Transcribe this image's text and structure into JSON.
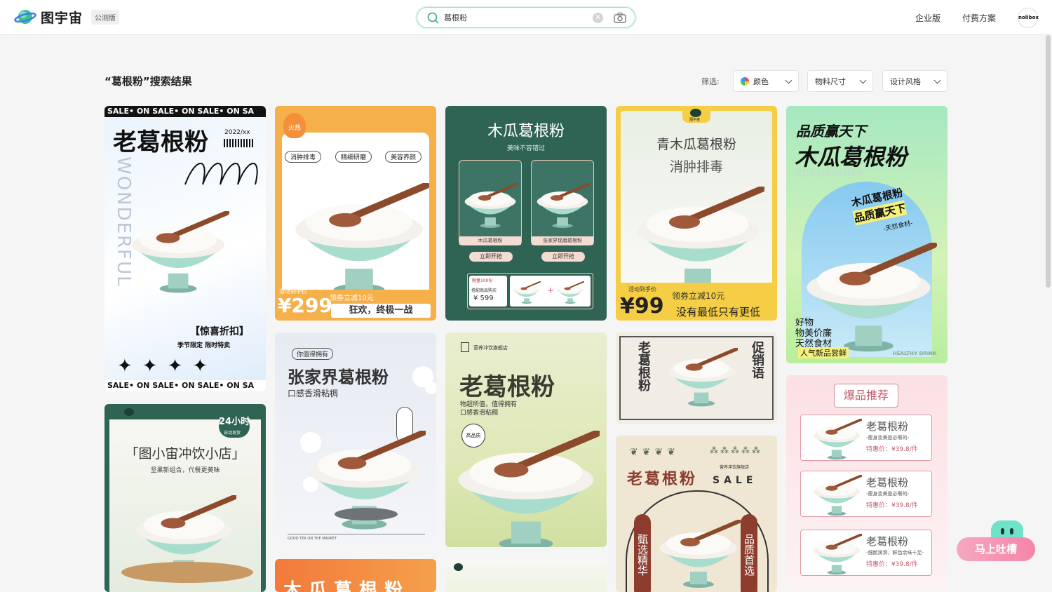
{
  "header": {
    "logo_text": "图宇宙",
    "beta_badge": "公测版",
    "search_value": "葛根粉",
    "nav_enterprise": "企业版",
    "nav_pricing": "付费方案",
    "avatar_text": "nolibox"
  },
  "toolbar": {
    "result_title": "“葛根粉”搜索结果",
    "filter_label": "筛选:",
    "filters": [
      "颜色",
      "物料尺寸",
      "设计风格"
    ]
  },
  "cards": {
    "c1": {
      "ticker": "SALE• ON  SALE• ON  SALE• ON  SA",
      "title": "老葛根粉",
      "year": "2022/xx",
      "vertical": "WONDERFUL",
      "promo": "【惊喜折扣】",
      "sub": "季节限定  限时特卖"
    },
    "c2": {
      "tag": "火热",
      "pills": [
        "消肿排毒",
        "精细研磨",
        "美容养颜"
      ],
      "price_label": "活动到手价",
      "price": "¥299",
      "coupon": "领券立减10元",
      "slogan": "狂欢，终极一战"
    },
    "c3": {
      "title": "木瓜葛根粉",
      "sub": "美味不容错过",
      "item1": "木瓜葛根粉",
      "item2": "张家界现磨葛根粉",
      "btn": "立即开抢",
      "limit": "限量100份",
      "combo": "搭配商品购买",
      "price": "¥ 599"
    },
    "c4": {
      "brand": "图宇宙",
      "title": "青木瓜葛根粉",
      "sub": "消肿排毒",
      "price_label": "活动到手价",
      "price": "¥99",
      "coupon": "领券立减10元",
      "slogan": "没有最低只有更低"
    },
    "c5": {
      "title1": "品质赢天下",
      "title2": "木瓜葛根粉",
      "tag": "#DELICIOUS#",
      "bubble1": "木瓜葛根粉",
      "bubble2": "品质赢天下",
      "bubble3": "-天然食材-",
      "feat1": "好物",
      "feat2": "物美价廉",
      "feat3": "天然食材",
      "feat4": "人气新品尝鲜",
      "foot": "HEALTHY DRINK"
    },
    "c6": {
      "tag": "你值得拥有",
      "title": "张家界葛根粉",
      "sub": "口感香滑粘稠",
      "foot": "GOOD TEA ON THE MARKET"
    },
    "c7": {
      "brand": "营养冲饮旗舰店",
      "title": "老葛根粉",
      "sub1": "物超所值，值得拥有",
      "sub2": "口感香滑粘稠",
      "badge": "高品质"
    },
    "c8": {
      "title": "老葛根粉",
      "right": "促销语"
    },
    "c9": {
      "title": "爆品推荐",
      "item": "老葛根粉",
      "desc1": "-瘦身变美是必需的-",
      "desc3": "-细腻润滑，鲜齿余味十足-",
      "price": "特惠价：¥39.8/件"
    },
    "c10": {
      "badge": "24小时",
      "badge_sub": "自动发货",
      "title": "「图小宙冲饮小店」",
      "sub": "坚果新组合，代餐更美味"
    },
    "c11": {
      "title": "老葛根粉",
      "brand": "营养冲饮旗舰店",
      "sale": "SALE",
      "left": "甄选精华",
      "right": "品质首选"
    },
    "c12": {
      "title": "木瓜葛根粉"
    }
  },
  "feedback": {
    "label": "马上吐槽"
  }
}
